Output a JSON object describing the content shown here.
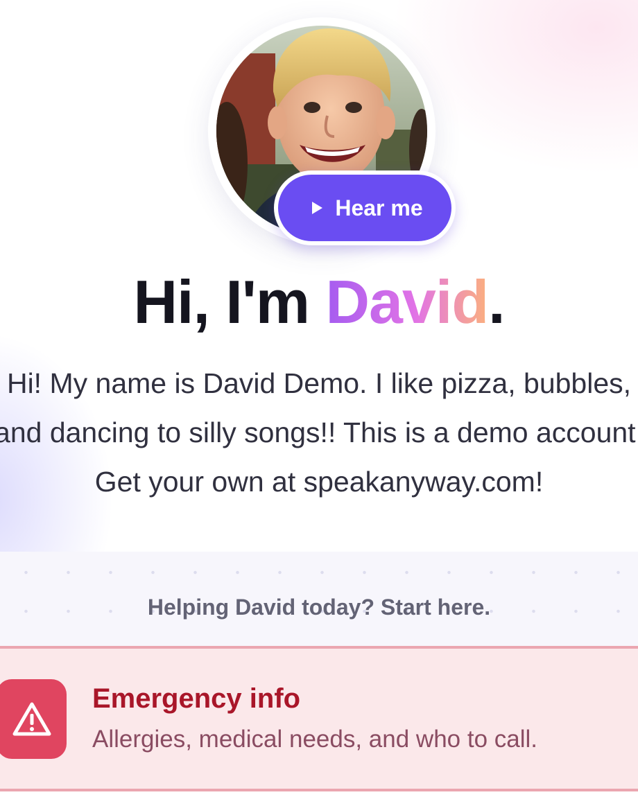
{
  "profile": {
    "photo_alt": "Smiling blond boy",
    "hear_button_label": "Hear me",
    "greeting_prefix": "Hi, I'm ",
    "name": "David",
    "greeting_suffix": ".",
    "bio_lines": [
      "Hi! My name is David Demo. I like pizza, bubbles,",
      "and dancing to silly songs!! This is a demo account.",
      "Get your own at speakanyway.com!"
    ]
  },
  "helper": {
    "prompt": "Helping David today? Start here."
  },
  "emergency": {
    "title": "Emergency info",
    "subtitle": "Allergies, medical needs, and who to call.",
    "icon": "warning-triangle-icon"
  },
  "colors": {
    "accent": "#6a4df2",
    "emergency_red": "#e04560",
    "emergency_bg": "#fbe8ea",
    "name_gradient": [
      "#a55cf0",
      "#e173e6",
      "#fbb07e"
    ]
  }
}
